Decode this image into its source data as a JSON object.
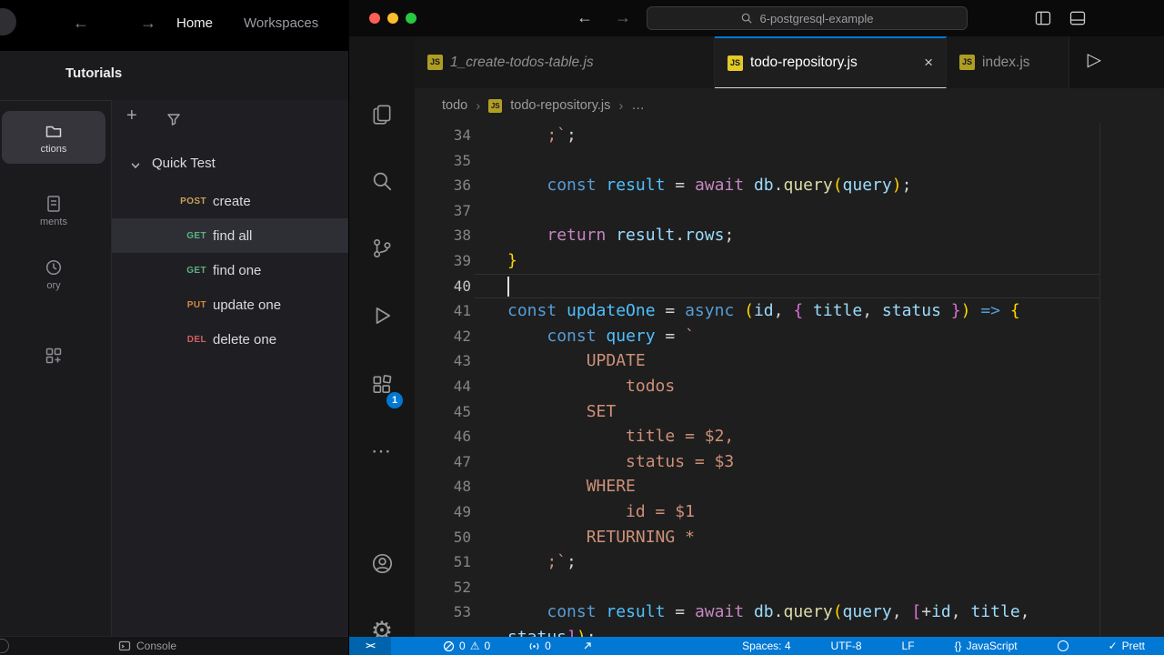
{
  "colors": {
    "accent": "#0078d4",
    "traffic": [
      "#ff5f57",
      "#febc2e",
      "#28c840"
    ],
    "js_icon_bg": "#e2ca27",
    "method": {
      "POST": "#c9a157",
      "GET": "#5bb381",
      "PUT": "#d08a3e",
      "DEL": "#d2605e"
    },
    "tokens": {
      "c1": "#569cd6",
      "c2": "#c586c0",
      "c3": "#4fc1ff",
      "c4": "#9cdcfe",
      "c5": "#dcdcaa",
      "c6": "#ce9178",
      "c7": "#d4d4d4",
      "b1": "#ffd700",
      "b2": "#da70d6"
    }
  },
  "icons": {
    "back": "←",
    "forward": "→",
    "close": "×",
    "more": "⋯",
    "gear": "⚙",
    "run": "▷",
    "crumb_sep": "›",
    "warning": "⚠",
    "check": "✓",
    "remote": "><",
    "add": "+",
    "js_label": "JS"
  },
  "left_app": {
    "header": {
      "home": "Home",
      "workspaces": "Workspaces"
    },
    "section_title": "Tutorials",
    "rail": [
      {
        "icon": "collections",
        "label": "ctions",
        "active": true
      },
      {
        "icon": "document",
        "label": "ments",
        "active": false
      },
      {
        "icon": "history",
        "label": "ory",
        "active": false
      },
      {
        "icon": "grid",
        "label": "",
        "active": false
      }
    ],
    "collection": {
      "name": "Quick Test"
    },
    "requests": [
      {
        "method": "POST",
        "name": "create",
        "selected": false
      },
      {
        "method": "GET",
        "name": "find all",
        "selected": true
      },
      {
        "method": "GET",
        "name": "find one",
        "selected": false
      },
      {
        "method": "PUT",
        "name": "update one",
        "selected": false
      },
      {
        "method": "DEL",
        "name": "delete one",
        "selected": false
      }
    ],
    "footer": {
      "console_label": "Console"
    }
  },
  "vscode": {
    "titlebar": {
      "search_value": "6-postgresql-example"
    },
    "tabs": [
      {
        "label": "1_create-todos-table.js",
        "state": "preview"
      },
      {
        "label": "todo-repository.js",
        "state": "active"
      },
      {
        "label": "index.js",
        "state": "normal"
      }
    ],
    "breadcrumb": {
      "folder": "todo",
      "file": "todo-repository.js",
      "more": "…"
    },
    "extensions_badge": "1",
    "code": {
      "lines": [
        {
          "n": "34",
          "t": [
            [
              "c6",
              "    ;`"
            ],
            [
              "c7",
              ";"
            ]
          ]
        },
        {
          "n": "35",
          "t": []
        },
        {
          "n": "36",
          "t": [
            [
              "c7",
              "    "
            ],
            [
              "c1",
              "const "
            ],
            [
              "c3",
              "result "
            ],
            [
              "c7",
              "= "
            ],
            [
              "c2",
              "await "
            ],
            [
              "c4",
              "db"
            ],
            [
              "c7",
              "."
            ],
            [
              "c5",
              "query"
            ],
            [
              "b1",
              "("
            ],
            [
              "c4",
              "query"
            ],
            [
              "b1",
              ")"
            ],
            [
              "c7",
              ";"
            ]
          ]
        },
        {
          "n": "37",
          "t": []
        },
        {
          "n": "38",
          "t": [
            [
              "c7",
              "    "
            ],
            [
              "c2",
              "return "
            ],
            [
              "c4",
              "result"
            ],
            [
              "c7",
              "."
            ],
            [
              "c4",
              "rows"
            ],
            [
              "c7",
              ";"
            ]
          ]
        },
        {
          "n": "39",
          "t": [
            [
              "b1",
              "}"
            ]
          ]
        },
        {
          "n": "40",
          "cur": true,
          "t": []
        },
        {
          "n": "41",
          "t": [
            [
              "c1",
              "const "
            ],
            [
              "c3",
              "updateOne "
            ],
            [
              "c7",
              "= "
            ],
            [
              "c1",
              "async "
            ],
            [
              "b1",
              "("
            ],
            [
              "c4",
              "id"
            ],
            [
              "c7",
              ", "
            ],
            [
              "b2",
              "{ "
            ],
            [
              "c4",
              "title"
            ],
            [
              "c7",
              ", "
            ],
            [
              "c4",
              "status"
            ],
            [
              "b2",
              " }"
            ],
            [
              "b1",
              ")"
            ],
            [
              "c7",
              " "
            ],
            [
              "c1",
              "=>"
            ],
            [
              "c7",
              " "
            ],
            [
              "b1",
              "{"
            ]
          ]
        },
        {
          "n": "42",
          "t": [
            [
              "c7",
              "    "
            ],
            [
              "c1",
              "const "
            ],
            [
              "c3",
              "query "
            ],
            [
              "c7",
              "= "
            ],
            [
              "c6",
              "`"
            ]
          ]
        },
        {
          "n": "43",
          "t": [
            [
              "c6",
              "        UPDATE"
            ]
          ]
        },
        {
          "n": "44",
          "t": [
            [
              "c6",
              "            todos"
            ]
          ]
        },
        {
          "n": "45",
          "t": [
            [
              "c6",
              "        SET"
            ]
          ]
        },
        {
          "n": "46",
          "t": [
            [
              "c6",
              "            title = $2,"
            ]
          ]
        },
        {
          "n": "47",
          "t": [
            [
              "c6",
              "            status = $3"
            ]
          ]
        },
        {
          "n": "48",
          "t": [
            [
              "c6",
              "        WHERE"
            ]
          ]
        },
        {
          "n": "49",
          "t": [
            [
              "c6",
              "            id = $1"
            ]
          ]
        },
        {
          "n": "50",
          "t": [
            [
              "c6",
              "        RETURNING *"
            ]
          ]
        },
        {
          "n": "51",
          "t": [
            [
              "c6",
              "    ;`"
            ],
            [
              "c7",
              ";"
            ]
          ]
        },
        {
          "n": "52",
          "t": []
        },
        {
          "n": "53",
          "t": [
            [
              "c7",
              "    "
            ],
            [
              "c1",
              "const "
            ],
            [
              "c3",
              "result "
            ],
            [
              "c7",
              "= "
            ],
            [
              "c2",
              "await "
            ],
            [
              "c4",
              "db"
            ],
            [
              "c7",
              "."
            ],
            [
              "c5",
              "query"
            ],
            [
              "b1",
              "("
            ],
            [
              "c4",
              "query"
            ],
            [
              "c7",
              ", "
            ],
            [
              "b2",
              "["
            ],
            [
              "c7",
              "+"
            ],
            [
              "c4",
              "id"
            ],
            [
              "c7",
              ", "
            ],
            [
              "c4",
              "title"
            ],
            [
              "c7",
              ","
            ]
          ]
        },
        {
          "n": "",
          "t": [
            [
              "c4",
              "status"
            ],
            [
              "b2",
              "]"
            ],
            [
              "b1",
              ")"
            ],
            [
              "c7",
              ";"
            ]
          ]
        }
      ]
    },
    "statusbar": {
      "errors": "0",
      "warnings": "0",
      "ports": "0",
      "spaces": "Spaces: 4",
      "encoding": "UTF-8",
      "eol": "LF",
      "language_icon": "{}",
      "language": "JavaScript",
      "formatter_check": "✓",
      "formatter": "Prett"
    }
  }
}
